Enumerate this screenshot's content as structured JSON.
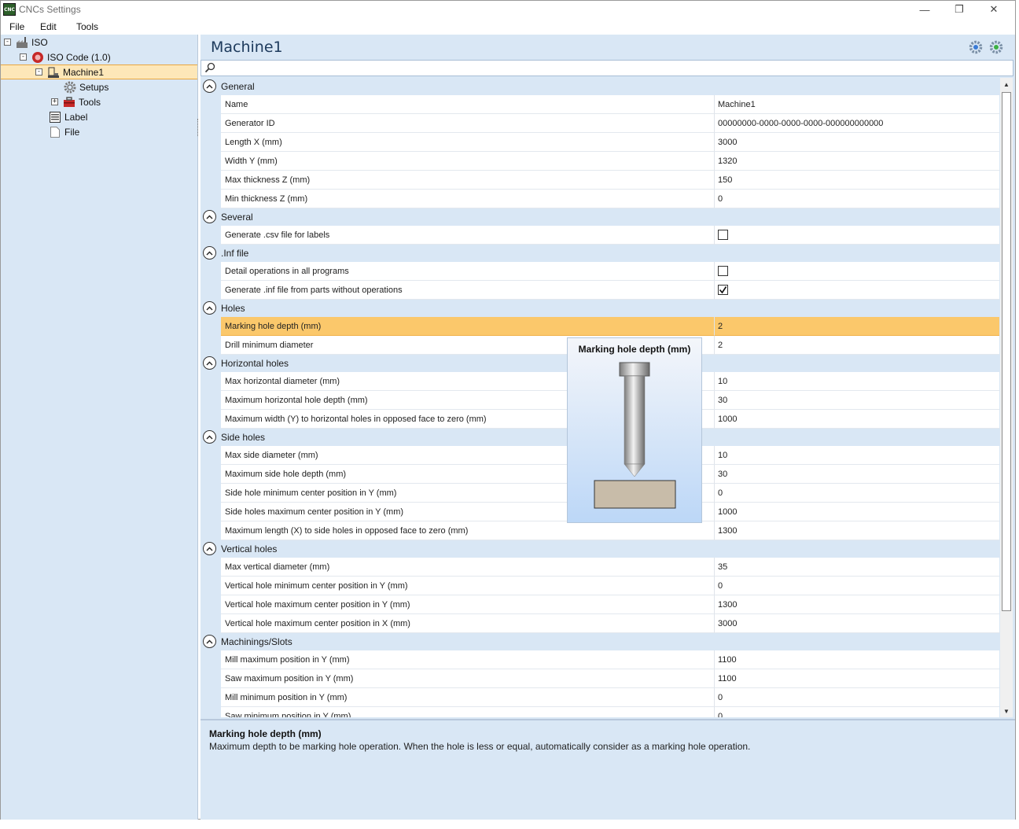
{
  "window": {
    "title": "CNCs Settings",
    "app_icon_text": "CNC"
  },
  "menu": [
    "File",
    "Edit",
    "Tools"
  ],
  "tree": {
    "nodes": [
      {
        "label": "ISO",
        "icon": "factory-icon",
        "expander": "minus"
      },
      {
        "label": "ISO Code (1.0)",
        "icon": "iso-code-icon",
        "expander": "minus"
      },
      {
        "label": "Machine1",
        "icon": "machine-icon",
        "expander": "minus",
        "selected": true
      },
      {
        "label": "Setups",
        "icon": "gear-icon"
      },
      {
        "label": "Tools",
        "icon": "toolbox-icon",
        "expander": "plus"
      },
      {
        "label": "Label",
        "icon": "label-icon"
      },
      {
        "label": "File",
        "icon": "file-icon"
      }
    ]
  },
  "main": {
    "title": "Machine1",
    "search": {
      "placeholder": "",
      "value": ""
    }
  },
  "grid": {
    "categories": [
      {
        "label": "General",
        "rows": [
          {
            "name": "Name",
            "value": "Machine1"
          },
          {
            "name": "Generator ID",
            "value": "00000000-0000-0000-0000-000000000000"
          },
          {
            "name": "Length X (mm)",
            "value": "3000"
          },
          {
            "name": "Width Y (mm)",
            "value": "1320"
          },
          {
            "name": "Max thickness Z (mm)",
            "value": "150"
          },
          {
            "name": "Min thickness Z (mm)",
            "value": "0"
          }
        ]
      },
      {
        "label": "Several",
        "rows": [
          {
            "name": "Generate .csv file for labels",
            "checkbox": false
          }
        ]
      },
      {
        "label": ".Inf file",
        "rows": [
          {
            "name": "Detail operations in all programs",
            "checkbox": false
          },
          {
            "name": "Generate .inf file from parts without operations",
            "checkbox": true
          }
        ]
      },
      {
        "label": "Holes",
        "rows": [
          {
            "name": "Marking hole depth (mm)",
            "value": "2",
            "selected": true
          },
          {
            "name": "Drill minimum diameter",
            "value": "2"
          }
        ]
      },
      {
        "label": "Horizontal holes",
        "rows": [
          {
            "name": "Max horizontal diameter (mm)",
            "value": "10"
          },
          {
            "name": "Maximum horizontal hole depth (mm)",
            "value": "30"
          },
          {
            "name": "Maximum width (Y) to horizontal holes in opposed face to zero (mm)",
            "value": "1000"
          }
        ]
      },
      {
        "label": "Side holes",
        "rows": [
          {
            "name": "Max side diameter (mm)",
            "value": "10"
          },
          {
            "name": "Maximum side hole depth (mm)",
            "value": "30"
          },
          {
            "name": "Side hole minimum center position in Y (mm)",
            "value": "0"
          },
          {
            "name": "Side holes maximum center position in Y (mm)",
            "value": "1000"
          },
          {
            "name": "Maximum length (X) to side holes in opposed face to zero (mm)",
            "value": "1300"
          }
        ]
      },
      {
        "label": "Vertical holes",
        "rows": [
          {
            "name": "Max vertical diameter (mm)",
            "value": "35"
          },
          {
            "name": "Vertical hole minimum center position in Y (mm)",
            "value": "0"
          },
          {
            "name": "Vertical hole maximum center position in Y (mm)",
            "value": "1300"
          },
          {
            "name": "Vertical hole maximum center position in X (mm)",
            "value": "3000"
          }
        ]
      },
      {
        "label": "Machinings/Slots",
        "rows": [
          {
            "name": "Mill maximum position in Y (mm)",
            "value": "1100"
          },
          {
            "name": "Saw maximum position in Y (mm)",
            "value": "1100"
          },
          {
            "name": "Mill minimum position in Y (mm)",
            "value": "0"
          },
          {
            "name": "Saw minimum position in Y (mm)",
            "value": "0"
          }
        ]
      }
    ]
  },
  "tooltip": {
    "title": "Marking hole depth (mm)"
  },
  "help": {
    "title": "Marking hole depth (mm)",
    "description": "Maximum depth to be marking hole operation. When the hole is less or equal, automatically consider as a marking hole operation."
  },
  "colors": {
    "panel_bg": "#d9e7f5",
    "selected_row": "#fbc86b",
    "tree_selected": "#fde7b8",
    "title_text": "#1d3a5c"
  }
}
